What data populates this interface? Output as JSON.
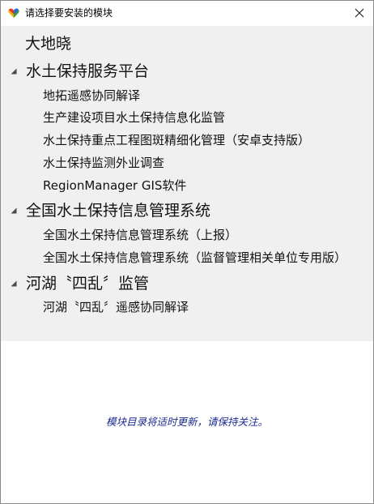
{
  "window": {
    "title": "请选择要安装的模块",
    "app_icon": "colorful-app-icon",
    "close_icon": "close-icon"
  },
  "tree": {
    "top_item": "大地晓",
    "groups": [
      {
        "label": "水土保持服务平台",
        "expanded": true,
        "children": [
          "地拓遥感协同解译",
          "生产建设项目水土保持信息化监管",
          "水土保持重点工程图斑精细化管理（安卓支持版）",
          "水土保持监测外业调查",
          "RegionManager GIS软件"
        ]
      },
      {
        "label": "全国水土保持信息管理系统",
        "expanded": true,
        "children": [
          "全国水土保持信息管理系统（上报）",
          "全国水土保持信息管理系统（监督管理相关单位专用版）"
        ]
      },
      {
        "label": "河湖〝四乱〞监管",
        "expanded": true,
        "children": [
          "河湖〝四乱〞遥感协同解译"
        ]
      }
    ]
  },
  "notice": "模块目录将适时更新，请保持关注。",
  "colors": {
    "panel_bg": "#f0f0f0",
    "notice_text": "#1a2b8f"
  }
}
